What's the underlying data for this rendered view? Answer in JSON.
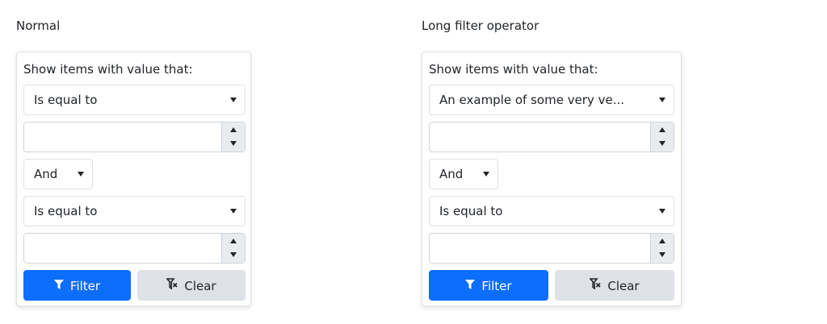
{
  "demos": [
    {
      "title": "Normal",
      "menu": {
        "info": "Show items with value that:",
        "first_operator": "Is equal to",
        "first_value": "",
        "logic": "And",
        "second_operator": "Is equal to",
        "second_value": "",
        "filter_label": "Filter",
        "clear_label": "Clear"
      }
    },
    {
      "title": "Long filter operator",
      "menu": {
        "info": "Show items with value that:",
        "first_operator": "An example of some very ve...",
        "first_value": "",
        "logic": "And",
        "second_operator": "Is equal to",
        "second_value": "",
        "filter_label": "Filter",
        "clear_label": "Clear"
      }
    }
  ],
  "icons": {
    "filter": "filter-icon",
    "clear": "filter-clear-icon"
  },
  "colors": {
    "primary": "#0d6efd",
    "secondary": "#dee2e6",
    "border": "#dee2e6"
  }
}
